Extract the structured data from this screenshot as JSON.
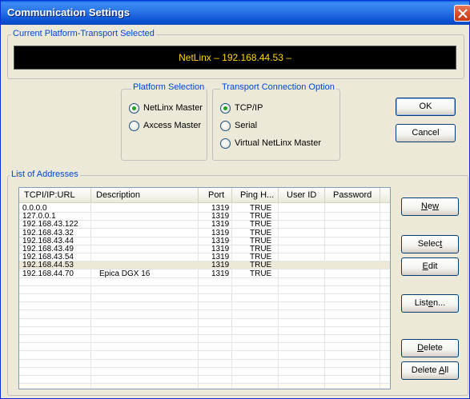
{
  "window": {
    "title": "Communication Settings"
  },
  "current": {
    "group_label": "Current Platform-Transport Selected",
    "display": "NetLinx – 192.168.44.53 –"
  },
  "platform": {
    "group_label": "Platform Selection",
    "options": [
      {
        "label": "NetLinx Master",
        "checked": true
      },
      {
        "label": "Axcess Master",
        "checked": false
      }
    ]
  },
  "transport": {
    "group_label": "Transport Connection Option",
    "options": [
      {
        "label": "TCP/IP",
        "checked": true
      },
      {
        "label": "Serial",
        "checked": false
      },
      {
        "label": "Virtual NetLinx Master",
        "checked": false
      }
    ]
  },
  "buttons": {
    "ok": "OK",
    "cancel": "Cancel",
    "new": "New",
    "select": "Select",
    "edit": "Edit",
    "listen": "Listen...",
    "delete": "Delete",
    "delete_all": "Delete All"
  },
  "addresses": {
    "group_label": "List of Addresses",
    "columns": [
      "TCPI/IP:URL",
      "Description",
      "Port",
      "Ping H...",
      "User ID",
      "Password"
    ],
    "rows": [
      [
        "0.0.0.0",
        "",
        "1319",
        "TRUE",
        "",
        ""
      ],
      [
        "127.0.0.1",
        "",
        "1319",
        "TRUE",
        "",
        ""
      ],
      [
        "192.168.43.122",
        "",
        "1319",
        "TRUE",
        "",
        ""
      ],
      [
        "192.168.43.32",
        "",
        "1319",
        "TRUE",
        "",
        ""
      ],
      [
        "192.168.43.44",
        "",
        "1319",
        "TRUE",
        "",
        ""
      ],
      [
        "192.168.43.49",
        "",
        "1319",
        "TRUE",
        "",
        ""
      ],
      [
        "192.168.43.54",
        "",
        "1319",
        "TRUE",
        "",
        ""
      ],
      [
        "192.168.44.53",
        "",
        "1319",
        "TRUE",
        "",
        ""
      ],
      [
        "192.168.44.70",
        "Epica DGX 16",
        "1319",
        "TRUE",
        "",
        ""
      ]
    ],
    "selected_index": 7
  }
}
